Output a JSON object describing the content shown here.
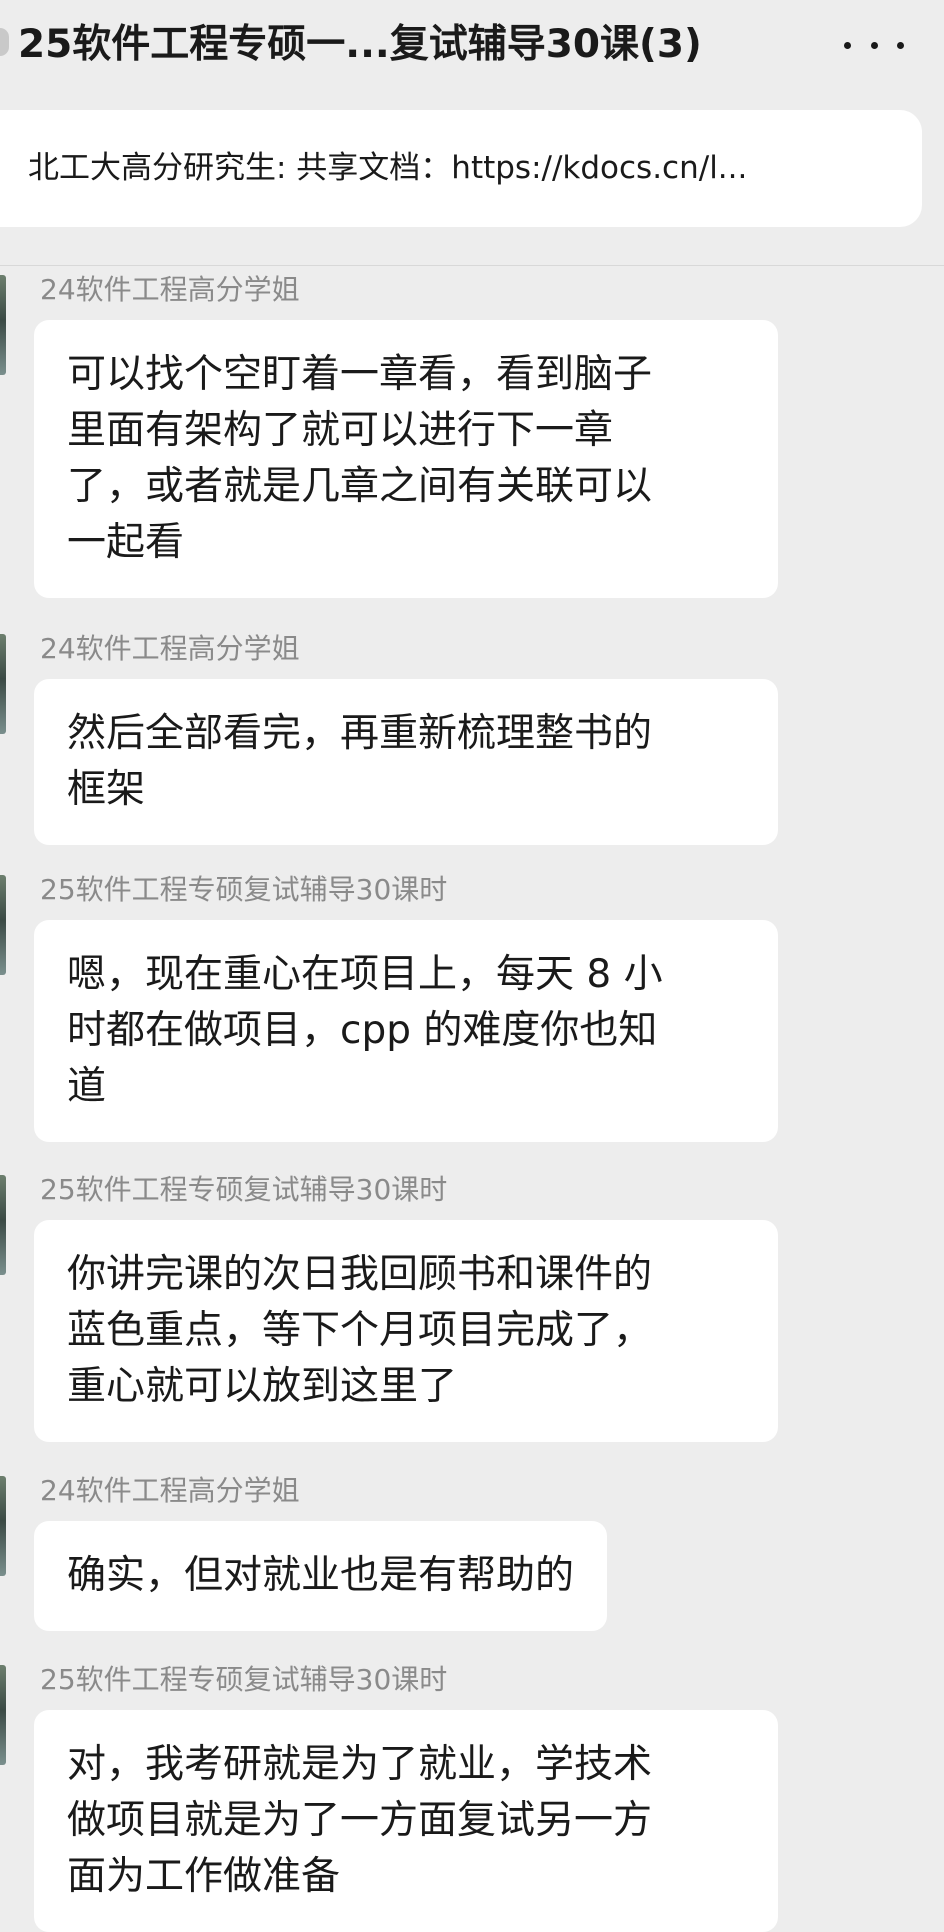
{
  "header": {
    "title": "25软件工程专硕一...复试辅导30课(3)",
    "more_icon": "more-icon"
  },
  "notice": {
    "text": "北工大高分研究生: 共享文档：https://kdocs.cn/l..."
  },
  "messages": [
    {
      "sender": "24软件工程高分学姐",
      "text": "可以找个空盯着一章看，看到脑子\n里面有架构了就可以进行下一章\n了，或者就是几章之间有关联可以\n一起看"
    },
    {
      "sender": "24软件工程高分学姐",
      "text": "然后全部看完，再重新梳理整书的\n框架"
    },
    {
      "sender": "25软件工程专硕复试辅导30课时",
      "text": "嗯，现在重心在项目上，每天 8 小\n时都在做项目，cpp 的难度你也知\n道"
    },
    {
      "sender": "25软件工程专硕复试辅导30课时",
      "text": "你讲完课的次日我回顾书和课件的\n蓝色重点，等下个月项目完成了，\n重心就可以放到这里了"
    },
    {
      "sender": "24软件工程高分学姐",
      "text": "确实，但对就业也是有帮助的"
    },
    {
      "sender": "25软件工程专硕复试辅导30课时",
      "text": "对，我考研就是为了就业，学技术\n做项目就是为了一方面复试另一方\n面为工作做准备"
    }
  ]
}
